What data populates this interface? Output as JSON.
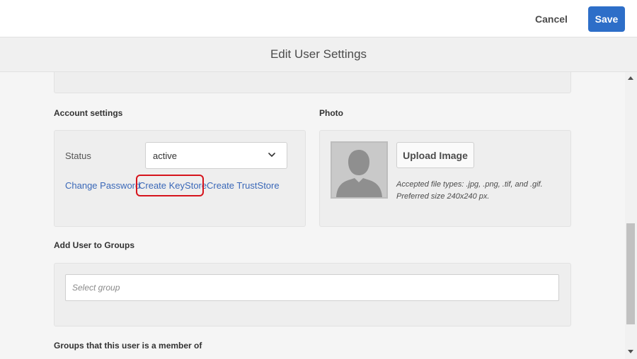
{
  "header": {
    "cancel_label": "Cancel",
    "save_label": "Save",
    "title": "Edit User Settings"
  },
  "account_settings": {
    "heading": "Account settings",
    "status_label": "Status",
    "status_value": "active",
    "links": {
      "change_password": "Change Password",
      "create_keystore": "Create KeyStore",
      "create_truststore": "Create TrustStore"
    }
  },
  "photo": {
    "heading": "Photo",
    "upload_label": "Upload Image",
    "hint_line1": "Accepted file types: .jpg, .png, .tif, and .gif.",
    "hint_line2": "Preferred size 240x240 px."
  },
  "groups": {
    "add_heading": "Add User to Groups",
    "select_placeholder": "Select group",
    "member_heading": "Groups that this user is a member of"
  },
  "colors": {
    "accent": "#2d6ec8",
    "link": "#3a68b8",
    "highlight": "#d6141c"
  }
}
